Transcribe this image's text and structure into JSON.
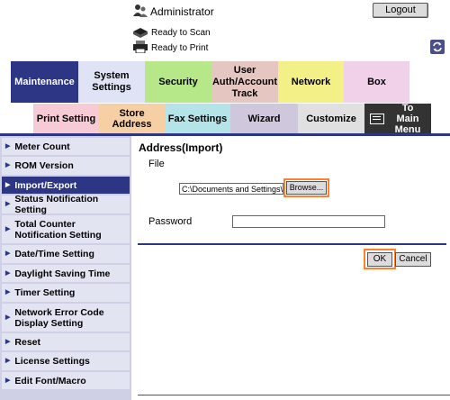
{
  "header": {
    "user": "Administrator",
    "logout_label": "Logout",
    "status_scan": "Ready to Scan",
    "status_print": "Ready to Print"
  },
  "tabs": [
    {
      "label": "Maintenance",
      "color": "#2d3585"
    },
    {
      "label": "System Settings",
      "color": "#dfe3f5"
    },
    {
      "label": "Security",
      "color": "#b6e88a"
    },
    {
      "label": "User Auth/Account Track",
      "color": "#e5c6c0"
    },
    {
      "label": "Network",
      "color": "#f3f087"
    },
    {
      "label": "Box",
      "color": "#f0d1e9"
    }
  ],
  "subtabs": [
    {
      "label": "Print Setting",
      "color": "#f6cbd5"
    },
    {
      "label": "Store Address",
      "color": "#f7cfa4"
    },
    {
      "label": "Fax Settings",
      "color": "#b5e4e8"
    },
    {
      "label": "Wizard",
      "color": "#cfc8dc"
    },
    {
      "label": "Customize",
      "color": "#e0e0e0"
    },
    {
      "label": "To Main Menu",
      "color": "#333333"
    }
  ],
  "sidebar": {
    "items": [
      {
        "label": "Meter Count"
      },
      {
        "label": "ROM Version"
      },
      {
        "label": "Import/Export"
      },
      {
        "label": "Status Notification Setting"
      },
      {
        "label": "Total Counter Notification Setting"
      },
      {
        "label": "Date/Time Setting"
      },
      {
        "label": "Daylight Saving Time"
      },
      {
        "label": "Timer Setting"
      },
      {
        "label": "Network Error Code Display Setting"
      },
      {
        "label": "Reset"
      },
      {
        "label": "License Settings"
      },
      {
        "label": "Edit Font/Macro"
      }
    ]
  },
  "main": {
    "title": "Address(Import)",
    "file_label": "File",
    "file_value": "C:\\Documents and Settings\\Ats",
    "browse_label": "Browse...",
    "password_label": "Password",
    "password_value": "",
    "ok_label": "OK",
    "cancel_label": "Cancel"
  },
  "colors": {
    "accent": "#2d3585",
    "highlight": "#ff8030"
  }
}
